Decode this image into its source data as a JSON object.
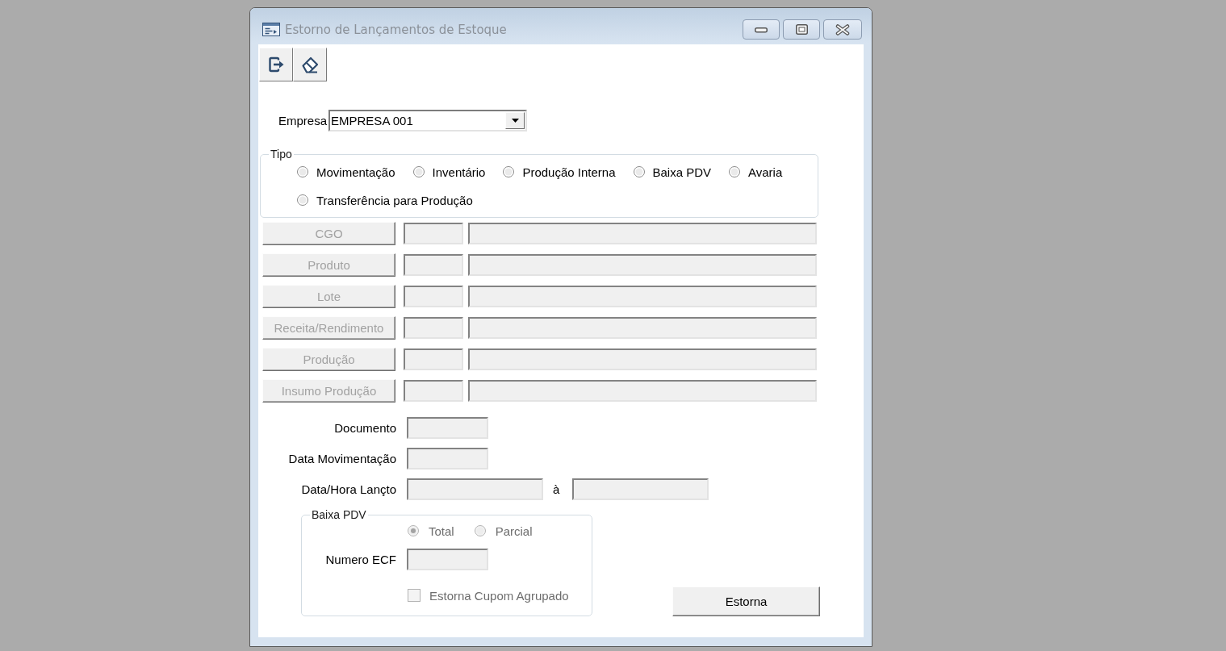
{
  "window": {
    "title": "Estorno de Lançamentos de Estoque"
  },
  "empresa": {
    "label": "Empresa",
    "value": "EMPRESA 001"
  },
  "tipo": {
    "legend": "Tipo",
    "options": [
      {
        "label": "Movimentação",
        "selected": false
      },
      {
        "label": "Inventário",
        "selected": false
      },
      {
        "label": "Produção Interna",
        "selected": false
      },
      {
        "label": "Baixa PDV",
        "selected": false
      },
      {
        "label": "Avaria",
        "selected": false
      },
      {
        "label": "Transferência para Produção",
        "selected": false
      }
    ]
  },
  "lookups": [
    {
      "button": "CGO",
      "disabled": true
    },
    {
      "button": "Produto",
      "disabled": true
    },
    {
      "button": "Lote",
      "disabled": true
    },
    {
      "button": "Receita/Rendimento",
      "disabled": true
    },
    {
      "button": "Produção",
      "disabled": true
    },
    {
      "button": "Insumo Produção",
      "disabled": true
    }
  ],
  "fields": [
    {
      "kind": "single",
      "label": "Documento",
      "disabled": true
    },
    {
      "kind": "single",
      "label": "Data Movimentação",
      "disabled": true
    },
    {
      "kind": "range",
      "label": "Data/Hora Lançto",
      "separator": "à",
      "disabled": true
    }
  ],
  "baixa_pdv": {
    "legend": "Baixa PDV",
    "modes": [
      {
        "label": "Total",
        "selected": true,
        "disabled": true
      },
      {
        "label": "Parcial",
        "selected": false,
        "disabled": true
      }
    ],
    "numero_ecf": {
      "label": "Numero ECF",
      "disabled": true
    },
    "agrupado": {
      "label": "Estorna Cupom Agrupado",
      "checked": false,
      "disabled": true
    }
  },
  "estorna_button": {
    "label": "Estorna"
  }
}
